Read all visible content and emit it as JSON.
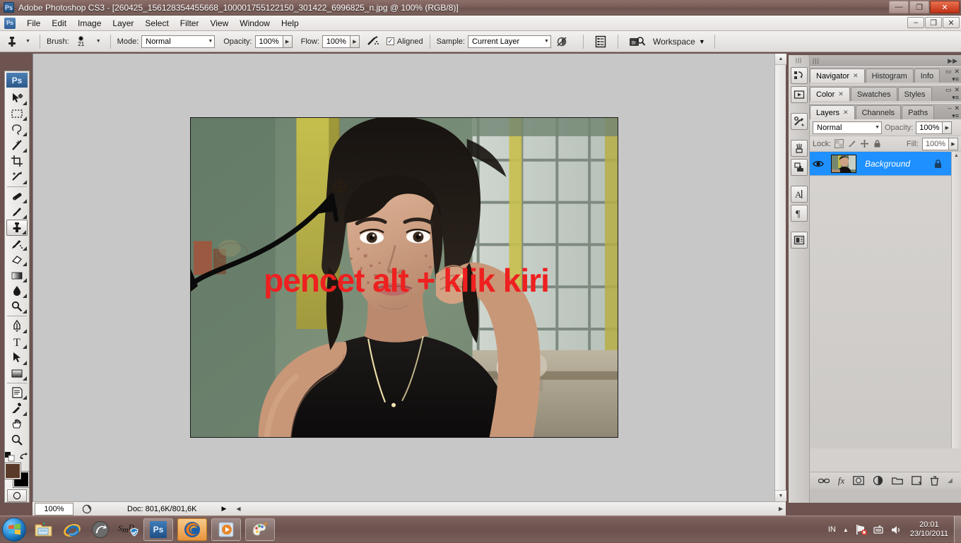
{
  "window": {
    "app_badge": "Ps",
    "title": "Adobe Photoshop CS3 - [260425_156128354455668_100001755122150_301422_6996825_n.jpg @ 100% (RGB/8)]",
    "minimize": "—",
    "maximize": "❐",
    "close": "✕",
    "doc_minimize": "–",
    "doc_restore": "❐",
    "doc_close": "✕"
  },
  "menubar": {
    "ps_badge": "Ps",
    "items": [
      {
        "label": "File"
      },
      {
        "label": "Edit"
      },
      {
        "label": "Image"
      },
      {
        "label": "Layer"
      },
      {
        "label": "Select"
      },
      {
        "label": "Filter"
      },
      {
        "label": "View"
      },
      {
        "label": "Window"
      },
      {
        "label": "Help"
      }
    ]
  },
  "options_bar": {
    "tool_icon": "clone-stamp-icon",
    "brush_label": "Brush:",
    "brush_size": "21",
    "mode_label": "Mode:",
    "mode_value": "Normal",
    "opacity_label": "Opacity:",
    "opacity_value": "100%",
    "flow_label": "Flow:",
    "flow_value": "100%",
    "airbrush_icon": "airbrush-icon",
    "aligned_checked": "✓",
    "aligned_label": "Aligned",
    "sample_label": "Sample:",
    "sample_value": "Current Layer",
    "ignore_adjustment_icon": "ignore-adjustment-layers-icon",
    "palette_toggle_icon": "palettes-icon",
    "bridge_icon": "bridge-icon",
    "bridge_badge": "Br",
    "workspace_label": "Workspace",
    "workspace_arrow": "▼"
  },
  "toolbar": {
    "ps_badge": "Ps",
    "tools": [
      {
        "name": "move-tool",
        "active": false
      },
      {
        "name": "rectangular-marquee-tool",
        "active": false
      },
      {
        "name": "lasso-tool",
        "active": false
      },
      {
        "name": "magic-wand-tool",
        "active": false
      },
      {
        "name": "crop-tool",
        "active": false
      },
      {
        "name": "slice-tool",
        "active": false
      },
      {
        "name": "healing-brush-tool",
        "active": false
      },
      {
        "name": "brush-tool",
        "active": false
      },
      {
        "name": "clone-stamp-tool",
        "active": true
      },
      {
        "name": "history-brush-tool",
        "active": false
      },
      {
        "name": "eraser-tool",
        "active": false
      },
      {
        "name": "gradient-tool",
        "active": false
      },
      {
        "name": "blur-tool",
        "active": false
      },
      {
        "name": "dodge-tool",
        "active": false
      },
      {
        "name": "pen-tool",
        "active": false
      },
      {
        "name": "type-tool",
        "active": false
      },
      {
        "name": "path-selection-tool",
        "active": false
      },
      {
        "name": "rectangle-shape-tool",
        "active": false
      },
      {
        "name": "notes-tool",
        "active": false
      },
      {
        "name": "eyedropper-tool",
        "active": false
      },
      {
        "name": "hand-tool",
        "active": false
      },
      {
        "name": "zoom-tool",
        "active": false
      }
    ],
    "foreground_color": "#5a3a28",
    "background_color": "#000000",
    "default_colors_icon": "default-colors-icon",
    "swap_colors_icon": "swap-colors-icon",
    "quick_mask_icon": "quick-mask-icon"
  },
  "canvas": {
    "annotation_text": "pencet alt + klik kiri",
    "annotation_color": "#ee2020",
    "clone_source_cursor": "clone-source-crosshair",
    "arrow_annotation": "black-arrow"
  },
  "status_bar": {
    "zoom_value": "100%",
    "preview_icon": "preview-icon",
    "doc_info": "Doc: 801,6K/801,6K",
    "more_arrow": "▶"
  },
  "dock_icons": [
    {
      "name": "history-panel-icon"
    },
    {
      "name": "actions-panel-icon"
    },
    {
      "name": "tool-presets-panel-icon"
    },
    {
      "name": "brushes-panel-icon"
    },
    {
      "name": "clone-source-panel-icon"
    },
    {
      "name": "character-panel-icon",
      "glyph": "A"
    },
    {
      "name": "paragraph-panel-icon",
      "glyph": "¶"
    },
    {
      "name": "layer-comps-panel-icon"
    }
  ],
  "panels": {
    "group1": {
      "tabs": [
        {
          "label": "Navigator",
          "active": true,
          "closable": true
        },
        {
          "label": "Histogram",
          "active": false,
          "closable": false
        },
        {
          "label": "Info",
          "active": false,
          "closable": false
        }
      ],
      "minimize": "▭",
      "close": "✕",
      "menu": "▾≡"
    },
    "group2": {
      "tabs": [
        {
          "label": "Color",
          "active": true,
          "closable": true
        },
        {
          "label": "Swatches",
          "active": false,
          "closable": false
        },
        {
          "label": "Styles",
          "active": false,
          "closable": false
        }
      ],
      "minimize": "▭",
      "close": "✕",
      "menu": "▾≡"
    },
    "layers": {
      "tabs": [
        {
          "label": "Layers",
          "active": true,
          "closable": true
        },
        {
          "label": "Channels",
          "active": false,
          "closable": false
        },
        {
          "label": "Paths",
          "active": false,
          "closable": false
        }
      ],
      "minimize": "–",
      "close": "✕",
      "menu": "▾≡",
      "blend_mode": "Normal",
      "opacity_label": "Opacity:",
      "opacity_value": "100%",
      "lock_label": "Lock:",
      "lock_icons": [
        {
          "name": "lock-transparent-pixels-icon"
        },
        {
          "name": "lock-image-pixels-icon"
        },
        {
          "name": "lock-position-icon"
        },
        {
          "name": "lock-all-icon"
        }
      ],
      "fill_label": "Fill:",
      "fill_value": "100%",
      "rows": [
        {
          "name": "Background",
          "visible": true,
          "locked": true,
          "selected": true,
          "eye_icon": "eye-icon",
          "lock_icon": "lock-icon"
        }
      ],
      "bottom_icons": [
        {
          "name": "link-layers-icon"
        },
        {
          "name": "layer-style-icon",
          "glyph": "fx"
        },
        {
          "name": "layer-mask-icon"
        },
        {
          "name": "adjustment-layer-icon"
        },
        {
          "name": "new-group-icon"
        },
        {
          "name": "new-layer-icon"
        },
        {
          "name": "delete-layer-icon"
        }
      ]
    }
  },
  "taskbar": {
    "start_icon": "windows-start-orb",
    "items": [
      {
        "name": "windows-explorer-icon",
        "pinned": true,
        "active": false
      },
      {
        "name": "internet-explorer-icon",
        "pinned": true,
        "active": false
      },
      {
        "name": "download-manager-icon",
        "pinned": true,
        "active": false
      },
      {
        "name": "smadav-icon",
        "pinned": true,
        "active": false
      },
      {
        "name": "photoshop-taskbar-button",
        "running": true,
        "active": false,
        "glyph": "Ps"
      },
      {
        "name": "firefox-taskbar-button",
        "running": true,
        "active": true
      },
      {
        "name": "media-player-taskbar-button",
        "running": true,
        "active": false
      },
      {
        "name": "paint-taskbar-button",
        "running": true,
        "active": false
      }
    ],
    "tray": {
      "language": "IN",
      "show_hidden_icons": "▲",
      "network_icon": "network-error-icon",
      "action_center_icon": "action-center-icon",
      "volume_icon": "volume-icon",
      "time": "20:01",
      "date": "23/10/2011"
    }
  }
}
